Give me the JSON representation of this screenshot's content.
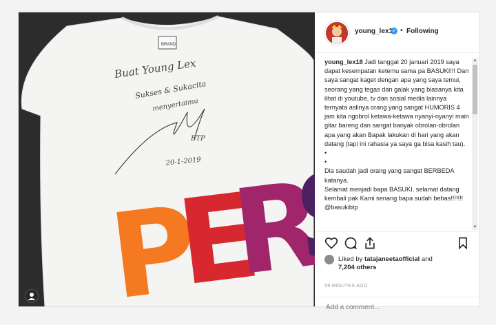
{
  "header": {
    "username": "young_lex18",
    "separator": "•",
    "follow_label": "Following"
  },
  "caption": {
    "username": "young_lex18",
    "paragraphs": [
      " Jadi tanggal 20 januari 2019 saya dapat kesempatan ketemu sama pa BASUKI!!! Dan saya sangat kaget dengan apa yang saya temui, seorang yang tegas dan galak yang biasanya kita lihat di youtube, tv dan sosial media lainnya ternyata aslinya orang yang sangat HUMORIS 4 jam kita ngobrol ketawa-ketawa nyanyi-nyanyi main gitar bareng dan sangat banyak obrolan-obrolan apa yang akan Bapak lakukan di hari yang akan datang (tapi ini rahasia ya saya ga bisa kasih tau).",
      "•",
      "•",
      "Dia saudah jadi orang yang sangat BERBEDA katanya.",
      "Selamat menjadi bapa BASUKI, selamat datang kembali pak Kami senang bapa sudah bebas!!!!!!! @basukibtp"
    ]
  },
  "photo": {
    "handwriting": [
      "Buat Young Lex",
      "Sukses & Sukacita",
      "menyertaimu",
      "BTP",
      "20-1-2019"
    ],
    "shirt_text": "PERS",
    "colors": {
      "P": "#f47920",
      "E": "#d7282f",
      "R": "#a0256a",
      "S": "#4b2163"
    }
  },
  "actions": {
    "icons": [
      "heart-icon",
      "comment-icon",
      "share-icon",
      "bookmark-icon"
    ]
  },
  "likes": {
    "prefix": "Liked by ",
    "user": "tatajaneetaofficial",
    "middle": " and",
    "count_text": "7,204 others"
  },
  "timestamp": "59 MINUTES AGO",
  "comment": {
    "placeholder": "Add a comment..."
  }
}
